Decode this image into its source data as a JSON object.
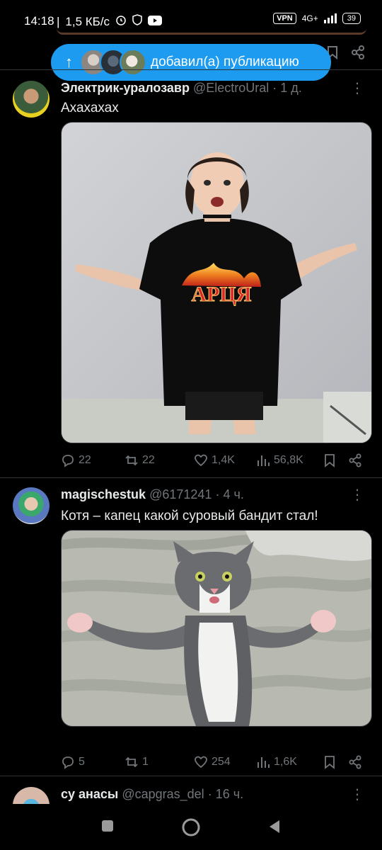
{
  "status_bar": {
    "time": "14:18",
    "speed": "1,5 КБ/с",
    "vpn": "VPN",
    "network": "4G+",
    "battery": "39"
  },
  "new_posts_pill": {
    "text": "добавил(а) публикацию",
    "arrow_icon": "arrow-up-icon"
  },
  "tweets": [
    {
      "name": "Электрик-уралозавр",
      "handle": "@ElectroUral",
      "time": "· 1 д.",
      "text": "Ахахахах",
      "replies": "22",
      "retweets": "22",
      "likes": "1,4K",
      "views": "56,8K"
    },
    {
      "name": "magischestuk",
      "handle": "@6171241",
      "time": "· 4 ч.",
      "text": "Котя – капец какой суровый бандит стал!",
      "replies": "5",
      "retweets": "1",
      "likes": "254",
      "views": "1,6K"
    },
    {
      "name": "су анасы",
      "handle": "@capgras_del",
      "time": "· 16 ч."
    }
  ],
  "colors": {
    "accent": "#1d9bf0",
    "muted": "#71767b",
    "text": "#e7e9ea",
    "background": "#000000"
  }
}
